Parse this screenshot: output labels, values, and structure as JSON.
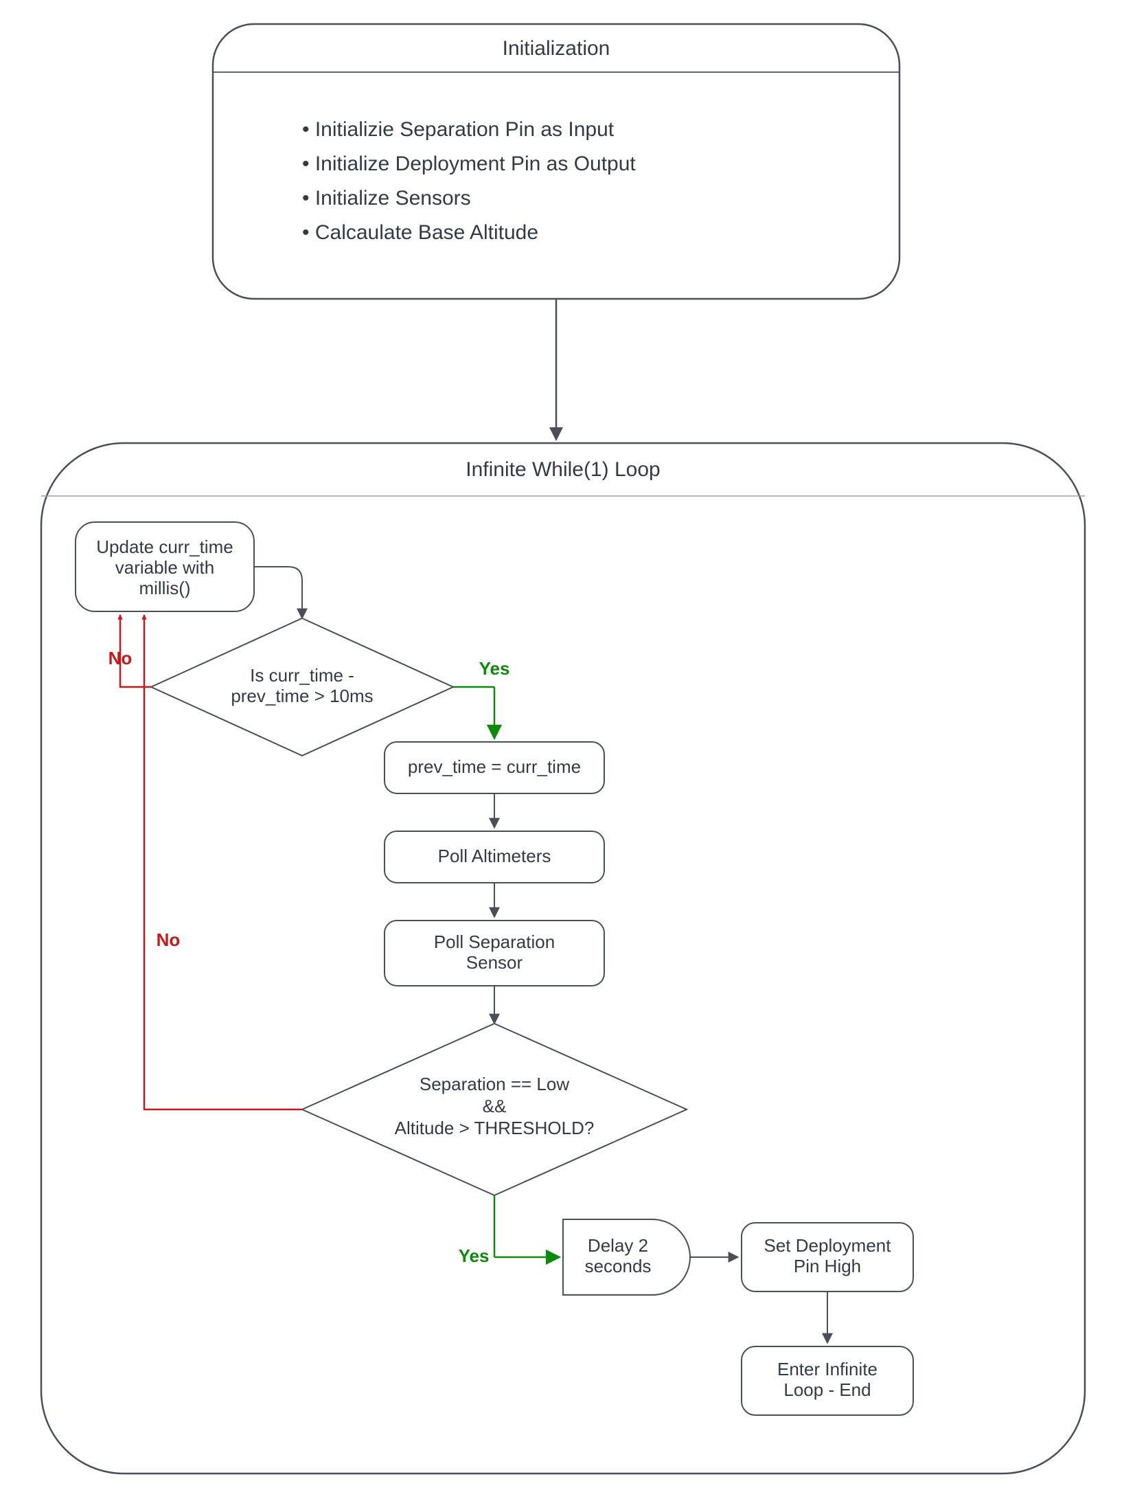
{
  "init": {
    "title": "Initialization",
    "bullets": [
      "Initializie Separation Pin as Input",
      "Initialize Deployment Pin as Output",
      "Initialize Sensors",
      "Calcaulate Base Altitude"
    ]
  },
  "loop": {
    "title": "Infinite While(1) Loop",
    "updateTime": {
      "l1": "Update curr_time",
      "l2": "variable with",
      "l3": "millis()"
    },
    "decision1": {
      "l1": "Is curr_time -",
      "l2": "prev_time > 10ms"
    },
    "assignPrev": "prev_time = curr_time",
    "pollAlt": "Poll Altimeters",
    "pollSep": {
      "l1": "Poll Separation",
      "l2": "Sensor"
    },
    "decision2": {
      "l1": "Separation == Low",
      "l2": "&&",
      "l3": "Altitude > THRESHOLD?"
    },
    "delay": {
      "l1": "Delay 2",
      "l2": "seconds"
    },
    "setPin": {
      "l1": "Set Deployment",
      "l2": "Pin High"
    },
    "end": {
      "l1": "Enter Infinite",
      "l2": "Loop - End"
    }
  },
  "labels": {
    "yes": "Yes",
    "no": "No"
  },
  "colors": {
    "stroke": "#4a4f57",
    "light": "#9aa0a8",
    "green": "#0b8a0b",
    "red": "#c61818",
    "fill": "#ffffff"
  }
}
